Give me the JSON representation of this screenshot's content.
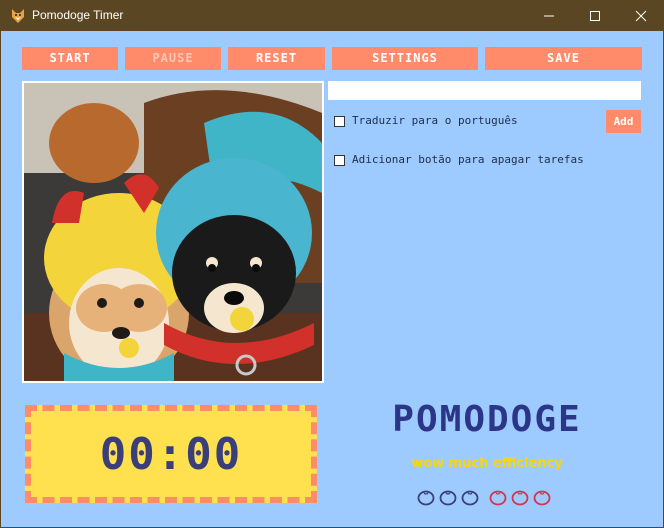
{
  "window": {
    "title": "Pomodoge Timer"
  },
  "toolbar": {
    "start_label": "START",
    "pause_label": "PAUSE",
    "reset_label": "RESET",
    "settings_label": "SETTINGS",
    "save_label": "SAVE"
  },
  "tasks": {
    "input_value": "",
    "options": [
      {
        "label": "Traduzir para o português",
        "checked": false
      },
      {
        "label": "Adicionar botão para apagar tarefas",
        "checked": false
      }
    ],
    "add_label": "Add"
  },
  "timer": {
    "display": "00:00"
  },
  "brand": {
    "title": "POMODOGE",
    "tagline": "wow much efficiency"
  },
  "pomodoros": {
    "completed_color": "#3a3f7a",
    "pending_color": "#d5334d",
    "completed": 3,
    "pending": 3
  },
  "colors": {
    "accent": "#ff8b6a",
    "background": "#9ecbff",
    "timer_bg": "#ffe04e",
    "brand": "#2c3688",
    "tagline": "#ffd400",
    "titlebar": "#5a4623"
  }
}
